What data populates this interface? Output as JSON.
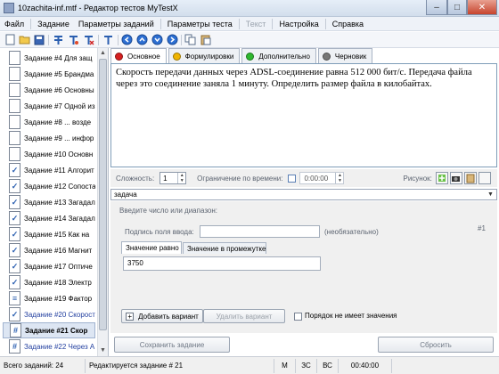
{
  "window": {
    "title": "10zachita-inf.mtf - Редактор тестов MyTestX"
  },
  "menu": [
    "Файл",
    "Задание",
    "Параметры заданий",
    "Параметры теста",
    "Текст",
    "Настройка",
    "Справка"
  ],
  "menu_disabled": [
    false,
    false,
    false,
    false,
    true,
    false,
    false
  ],
  "tasks": [
    {
      "label": "Задание #4 Для защ",
      "icon": "text"
    },
    {
      "label": "Задание #5 Брандма",
      "icon": "text"
    },
    {
      "label": "Задание #6 Основны",
      "icon": "text"
    },
    {
      "label": "Задание #7 Одной из",
      "icon": "text"
    },
    {
      "label": "Задание #8 ... возде",
      "icon": "text"
    },
    {
      "label": "Задание #9 ... инфор",
      "icon": "text"
    },
    {
      "label": "Задание #10 Основн",
      "icon": "text"
    },
    {
      "label": "Задание #11 Алгорит",
      "icon": "check"
    },
    {
      "label": "Задание #12 Сопоста",
      "icon": "check"
    },
    {
      "label": "Задание #13 Загадал",
      "icon": "check"
    },
    {
      "label": "Задание #14 Загадал",
      "icon": "check"
    },
    {
      "label": "Задание #15 Как на",
      "icon": "check"
    },
    {
      "label": "Задание #16 Магнит",
      "icon": "check"
    },
    {
      "label": "Задание #17 Оптиче",
      "icon": "check"
    },
    {
      "label": "Задание #18 Электр",
      "icon": "check"
    },
    {
      "label": "Задание #19 Фактор",
      "icon": "list"
    },
    {
      "label": "Задание #20 Скорост",
      "icon": "check"
    },
    {
      "label": "Задание #21 Скор",
      "icon": "number"
    },
    {
      "label": "Задание #22 Через А",
      "icon": "number"
    }
  ],
  "tabs": [
    {
      "label": "Основное",
      "color": "#d62020"
    },
    {
      "label": "Формулировки",
      "color": "#f0b400"
    },
    {
      "label": "Дополнительно",
      "color": "#2fb82f"
    },
    {
      "label": "Черновик",
      "color": "#777777"
    }
  ],
  "question_text": "Скорость передачи данных через ADSL-соединение равна 512 000 бит/с. Передача файла через это соединение заняла 1 минуту. Определить размер файла в килобайтах.",
  "options": {
    "complexity_label": "Сложность:",
    "complexity_value": "1",
    "time_limit_label": "Ограничение по времени:",
    "time_value": "0:00:00",
    "picture_label": "Рисунок:"
  },
  "type_label": "задача",
  "answer": {
    "hint": "Введите число или диапазон:",
    "field_caption_label": "Подпись поля ввода:",
    "optional": "(необязательно)",
    "number": "#1",
    "tab_exact": "Значение равно",
    "tab_range": "Значение в промежутке",
    "value": "3750",
    "add_button": "Добавить вариант",
    "delete_button": "Удалить вариант",
    "order_label": "Порядок не имеет значения"
  },
  "buttons": {
    "save": "Сохранить задание",
    "reset": "Сбросить"
  },
  "status": {
    "total": "Всего заданий: 24",
    "editing": "Редактируется задание # 21",
    "m": "M",
    "zs": "ЗС",
    "vs": "ВС",
    "time": "00:40:00"
  }
}
